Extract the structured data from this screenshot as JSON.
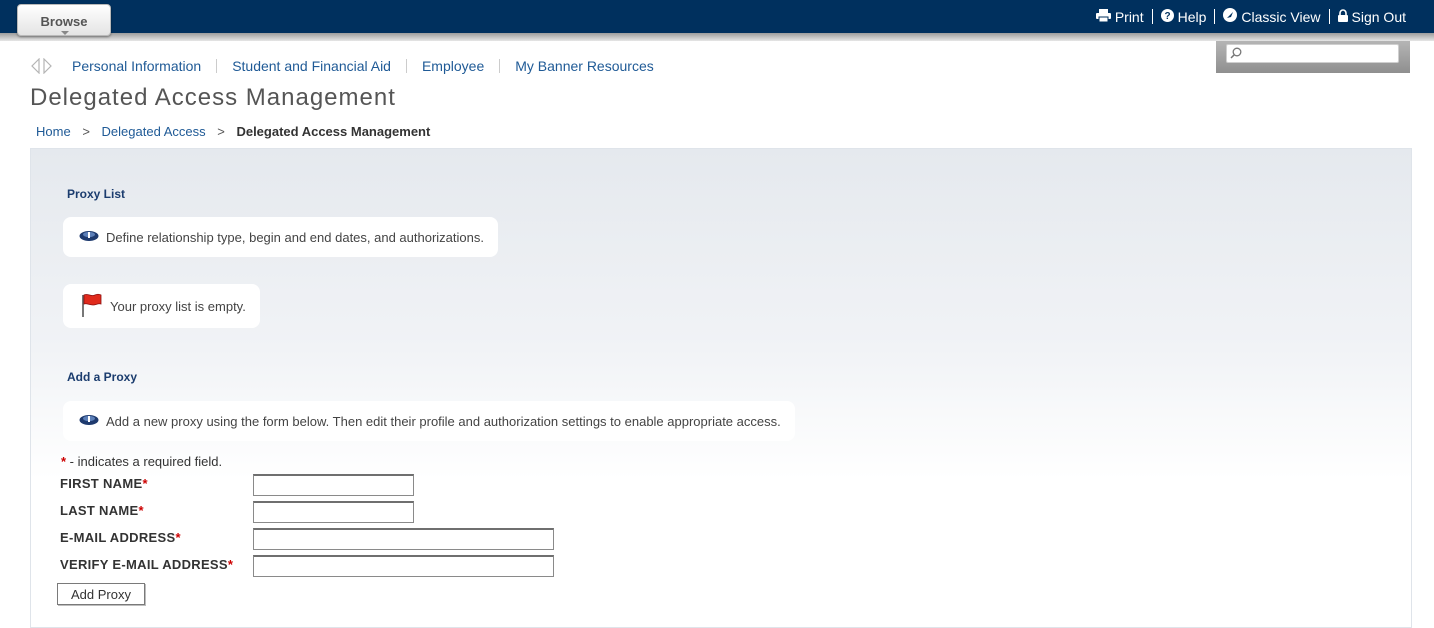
{
  "topbar": {
    "browse_label": "Browse",
    "util": [
      {
        "label": "Print",
        "icon": "printer-icon"
      },
      {
        "label": "Help",
        "icon": "help-icon"
      },
      {
        "label": "Classic View",
        "icon": "classic-view-icon"
      },
      {
        "label": "Sign Out",
        "icon": "lock-icon"
      }
    ]
  },
  "search": {
    "placeholder": ""
  },
  "menu": {
    "items": [
      "Personal Information",
      "Student and Financial Aid",
      "Employee",
      "My Banner Resources"
    ]
  },
  "page": {
    "title": "Delegated Access Management"
  },
  "breadcrumb": {
    "home": "Home",
    "parent": "Delegated Access",
    "sep": ">",
    "current": "Delegated Access Management"
  },
  "proxy_list": {
    "title": "Proxy List",
    "info": "Define relationship type, begin and end dates, and authorizations.",
    "warning": "Your proxy list is empty."
  },
  "add_proxy": {
    "title": "Add a Proxy",
    "info": "Add a new proxy using the form below. Then edit their profile and authorization settings to enable appropriate access.",
    "required_star": "*",
    "required_note": " - indicates a required field.",
    "fields": [
      {
        "label": "FIRST NAME",
        "value": ""
      },
      {
        "label": "LAST NAME",
        "value": ""
      },
      {
        "label": "E-MAIL ADDRESS",
        "value": ""
      },
      {
        "label": "VERIFY E-MAIL ADDRESS",
        "value": ""
      }
    ],
    "button_label": "Add Proxy"
  },
  "colors": {
    "header_bg": "#00305e",
    "link": "#1f5a96",
    "required": "#cc0000",
    "section_title": "#1b3c6e"
  }
}
